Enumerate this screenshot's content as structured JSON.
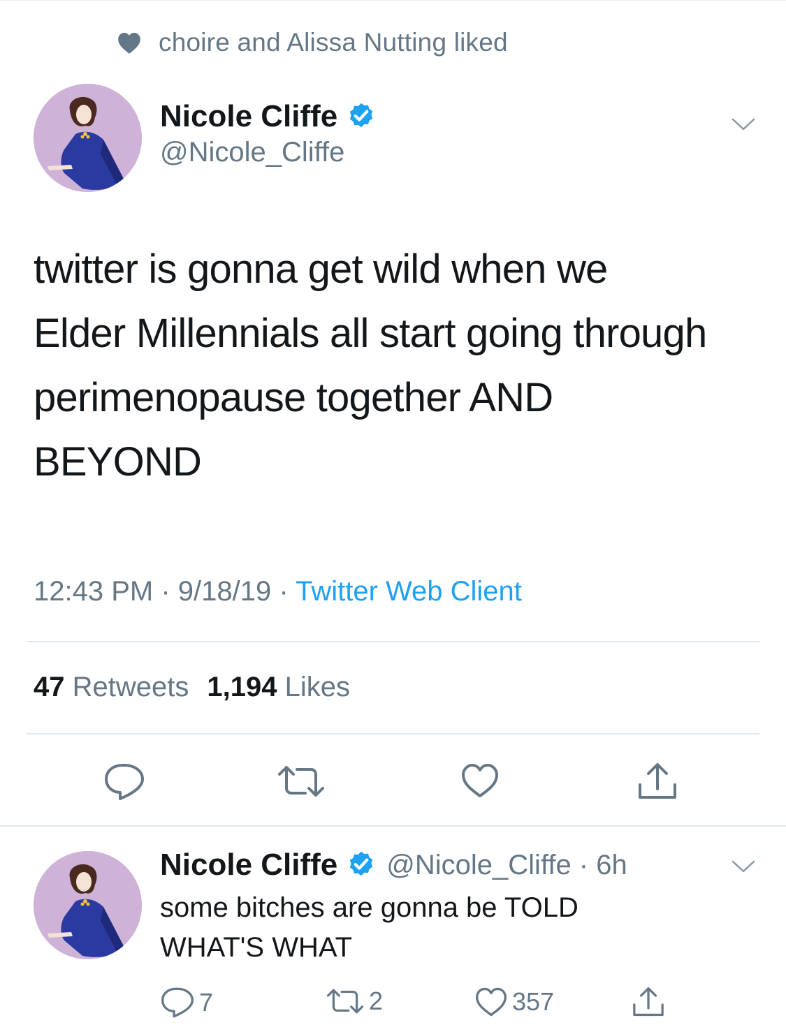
{
  "social_context": {
    "icon": "heart-icon",
    "text": "choire and Alissa Nutting liked"
  },
  "tweet": {
    "author_name": "Nicole Cliffe",
    "author_handle": "@Nicole_Cliffe",
    "verified": true,
    "text_lines": [
      "twitter is gonna get wild when we",
      "Elder Millennials all start going through",
      "perimenopause together AND",
      "BEYOND"
    ],
    "time": "12:43 PM",
    "date": "9/18/19",
    "source": "Twitter Web Client",
    "retweet_count": "47",
    "retweet_label": "Retweets",
    "like_count": "1,194",
    "like_label": "Likes"
  },
  "reply": {
    "author_name": "Nicole Cliffe",
    "handle_time": "@Nicole_Cliffe · 6h",
    "text_lines": [
      "some bitches are gonna be TOLD",
      "WHAT'S WHAT"
    ],
    "reply_count": "7",
    "retweet_count": "2",
    "like_count": "357"
  },
  "colors": {
    "accent": "#1da1f2",
    "muted": "#657786",
    "text": "#14171a",
    "divider": "#e1e8ed"
  }
}
